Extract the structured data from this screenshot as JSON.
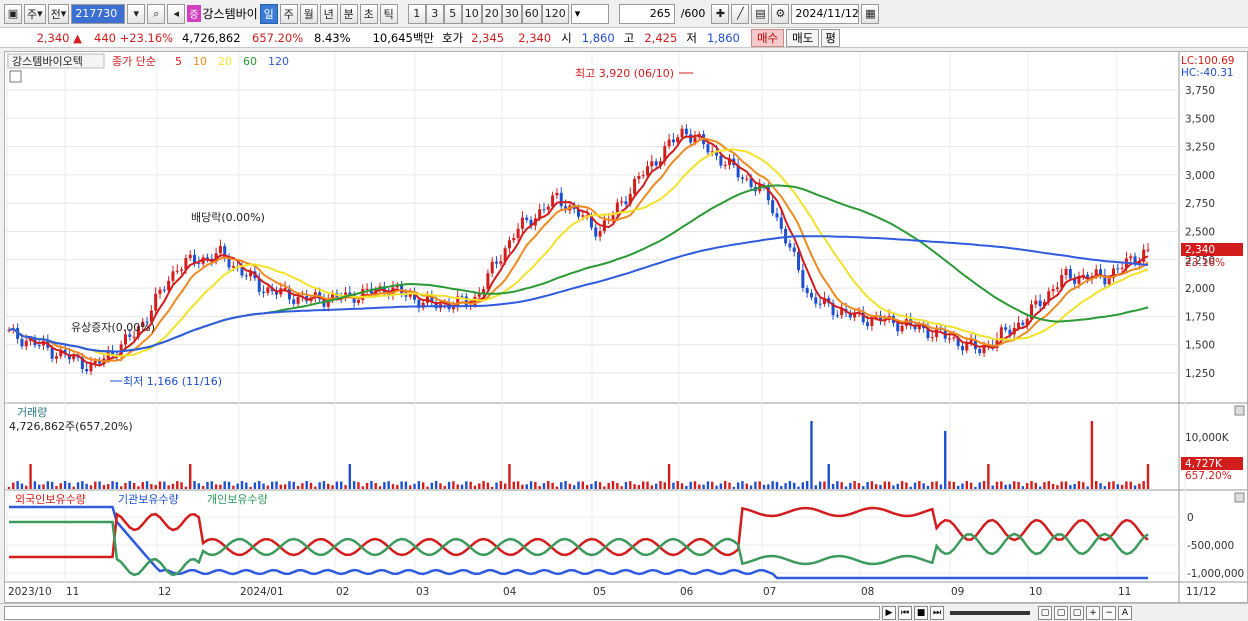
{
  "toolbar": {
    "period_label": "주",
    "prev_label": "전",
    "code": "217730",
    "name_badge": "증",
    "stock_name": "강스템바이",
    "tf_day": "일",
    "tf_week": "주",
    "tf_month": "월",
    "tf_year": "년",
    "tf_min": "분",
    "tf_sec": "초",
    "tf_tick": "틱",
    "n_buttons": [
      "1",
      "3",
      "5",
      "10",
      "20",
      "30",
      "60",
      "120"
    ],
    "count_value": "265",
    "count_max": "/600",
    "date_value": "2024/11/12"
  },
  "quote": {
    "price": "2,340",
    "change": "440",
    "change_pct": "+23.16%",
    "volume": "4,726,862",
    "vol_ratio": "657.20%",
    "turnover": "8.43%",
    "amount": "10,645백만",
    "bid_label": "호가",
    "bid1": "2,345",
    "bid2": "2,340",
    "open_label": "시",
    "open": "1,860",
    "high_label": "고",
    "high": "2,425",
    "low_label": "저",
    "low": "1,860",
    "buy_label": "매수",
    "sell_label": "매도",
    "flat_label": "평"
  },
  "legend": {
    "name": "강스템바이오텍",
    "ma_label": "종가 단순",
    "ma_periods": [
      "5",
      "10",
      "20",
      "60",
      "120"
    ],
    "ma_colors": [
      "#d31c1c",
      "#ef8a1f",
      "#f2e22a",
      "#2a9a34",
      "#2f5bdf"
    ]
  },
  "price_axis": {
    "lc": "LC:100.69",
    "hc": "HC:-40.31",
    "ticks": [
      "3,750",
      "3,500",
      "3,250",
      "3,000",
      "2,750",
      "2,500",
      "2,250",
      "2,000",
      "1,750",
      "1,500",
      "1,250"
    ],
    "current_price": "2,340",
    "current_pct": "23.16%"
  },
  "annotations": {
    "high": "최고 3,920 (06/10)",
    "low": "최저 1,166 (11/16)",
    "dividend": "배당락(0.00%)",
    "rights": "유상증자(0.00%)"
  },
  "volume_panel": {
    "title": "거래량",
    "value": "4,726,862주(657.20%)",
    "tick": "10,000K",
    "current": "4,727K",
    "current_pct": "657.20%"
  },
  "holdings_panel": {
    "foreign": "외국인보유수량",
    "institution": "기관보유수량",
    "individual": "개인보유수량",
    "ticks": [
      "0",
      "-500,000",
      "-1,000,000"
    ]
  },
  "x_axis": {
    "labels": [
      "2023/10",
      "11",
      "12",
      "2024/01",
      "02",
      "03",
      "04",
      "05",
      "06",
      "07",
      "08",
      "09",
      "10",
      "11",
      "11/12"
    ]
  },
  "colors": {
    "up": "#d31c1c",
    "down": "#1e4fd0",
    "selected": "#3a7bd5"
  },
  "chart_data": {
    "type": "candlestick",
    "title": "강스템바이오텍",
    "period_labels": [
      "2023/10",
      "11",
      "12",
      "2024/01",
      "02",
      "03",
      "04",
      "05",
      "06",
      "07",
      "08",
      "09",
      "10",
      "11"
    ],
    "close_approx": [
      1600,
      1450,
      1300,
      1600,
      2200,
      2300,
      2000,
      1900,
      1920,
      2000,
      1850,
      1880,
      2500,
      2800,
      2500,
      3000,
      3400,
      3100,
      2800,
      1900,
      1750,
      1700,
      1600,
      1450,
      1700,
      2100,
      2100,
      2340
    ],
    "y_ticks": [
      1250,
      1500,
      1750,
      2000,
      2250,
      2500,
      2750,
      3000,
      3250,
      3500,
      3750
    ],
    "high": 3920,
    "low": 1166,
    "last": 2340
  }
}
